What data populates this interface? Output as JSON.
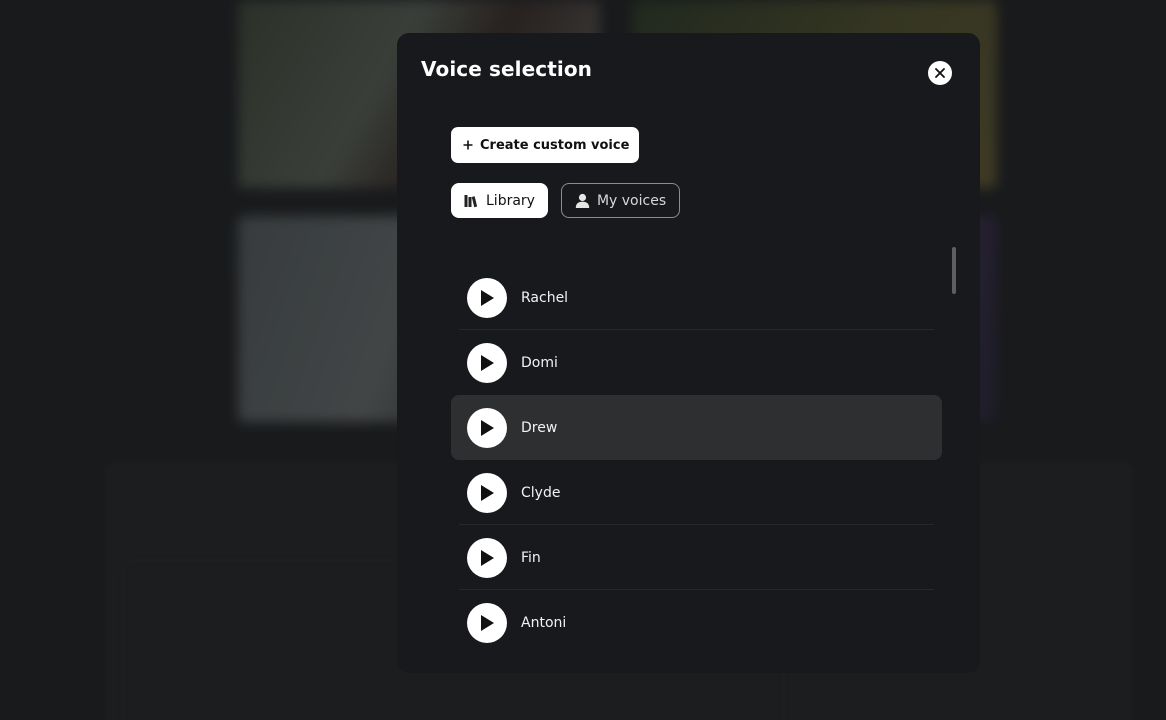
{
  "modal": {
    "title": "Voice selection",
    "create_button_label": "Create custom voice",
    "tabs": [
      {
        "label": "Library",
        "icon": "library-icon",
        "active": true
      },
      {
        "label": "My voices",
        "icon": "user-icon",
        "active": false
      }
    ],
    "voices": [
      {
        "name": "Rachel",
        "selected": false
      },
      {
        "name": "Domi",
        "selected": false
      },
      {
        "name": "Drew",
        "selected": true
      },
      {
        "name": "Clyde",
        "selected": false
      },
      {
        "name": "Fin",
        "selected": false
      },
      {
        "name": "Antoni",
        "selected": false
      }
    ]
  },
  "colors": {
    "modal_background": "#18191c",
    "selected_row": "#2e2f31",
    "button_background": "#ffffff"
  }
}
